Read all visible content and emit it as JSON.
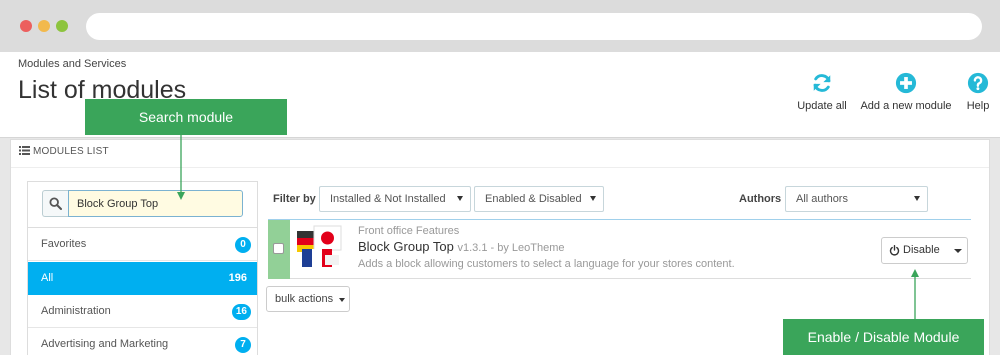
{
  "header": {
    "breadcrumb": "Modules and Services",
    "title": "List of modules",
    "toolbar": [
      {
        "label": "Update all",
        "icon": "refresh-icon"
      },
      {
        "label": "Add a new module",
        "icon": "plus-circle-icon"
      },
      {
        "label": "Help",
        "icon": "question-circle-icon"
      }
    ]
  },
  "panel": {
    "heading": "MODULES LIST"
  },
  "search": {
    "value": "Block Group Top"
  },
  "categories": [
    {
      "label": "Favorites",
      "count": "0"
    },
    {
      "label": "All",
      "count": "196",
      "active": true
    },
    {
      "label": "Administration",
      "count": "16"
    },
    {
      "label": "Advertising and Marketing",
      "count": "7"
    }
  ],
  "filters": {
    "filter_by_label": "Filter by",
    "install_filter": "Installed & Not Installed",
    "status_filter": "Enabled & Disabled",
    "authors_label": "Authors",
    "authors_filter": "All authors"
  },
  "module": {
    "tab": "Front office Features",
    "name": "Block Group Top",
    "meta": "v1.3.1 - by LeoTheme",
    "description": "Adds a block allowing customers to select a language for your stores content.",
    "action_label": "Disable"
  },
  "bulk_actions_label": "bulk actions",
  "callouts": {
    "search": "Search module",
    "enable": "Enable / Disable Module"
  },
  "colors": {
    "accent": "#00aff0",
    "callout": "#3aa55a",
    "enabled_row": "#92d097"
  }
}
